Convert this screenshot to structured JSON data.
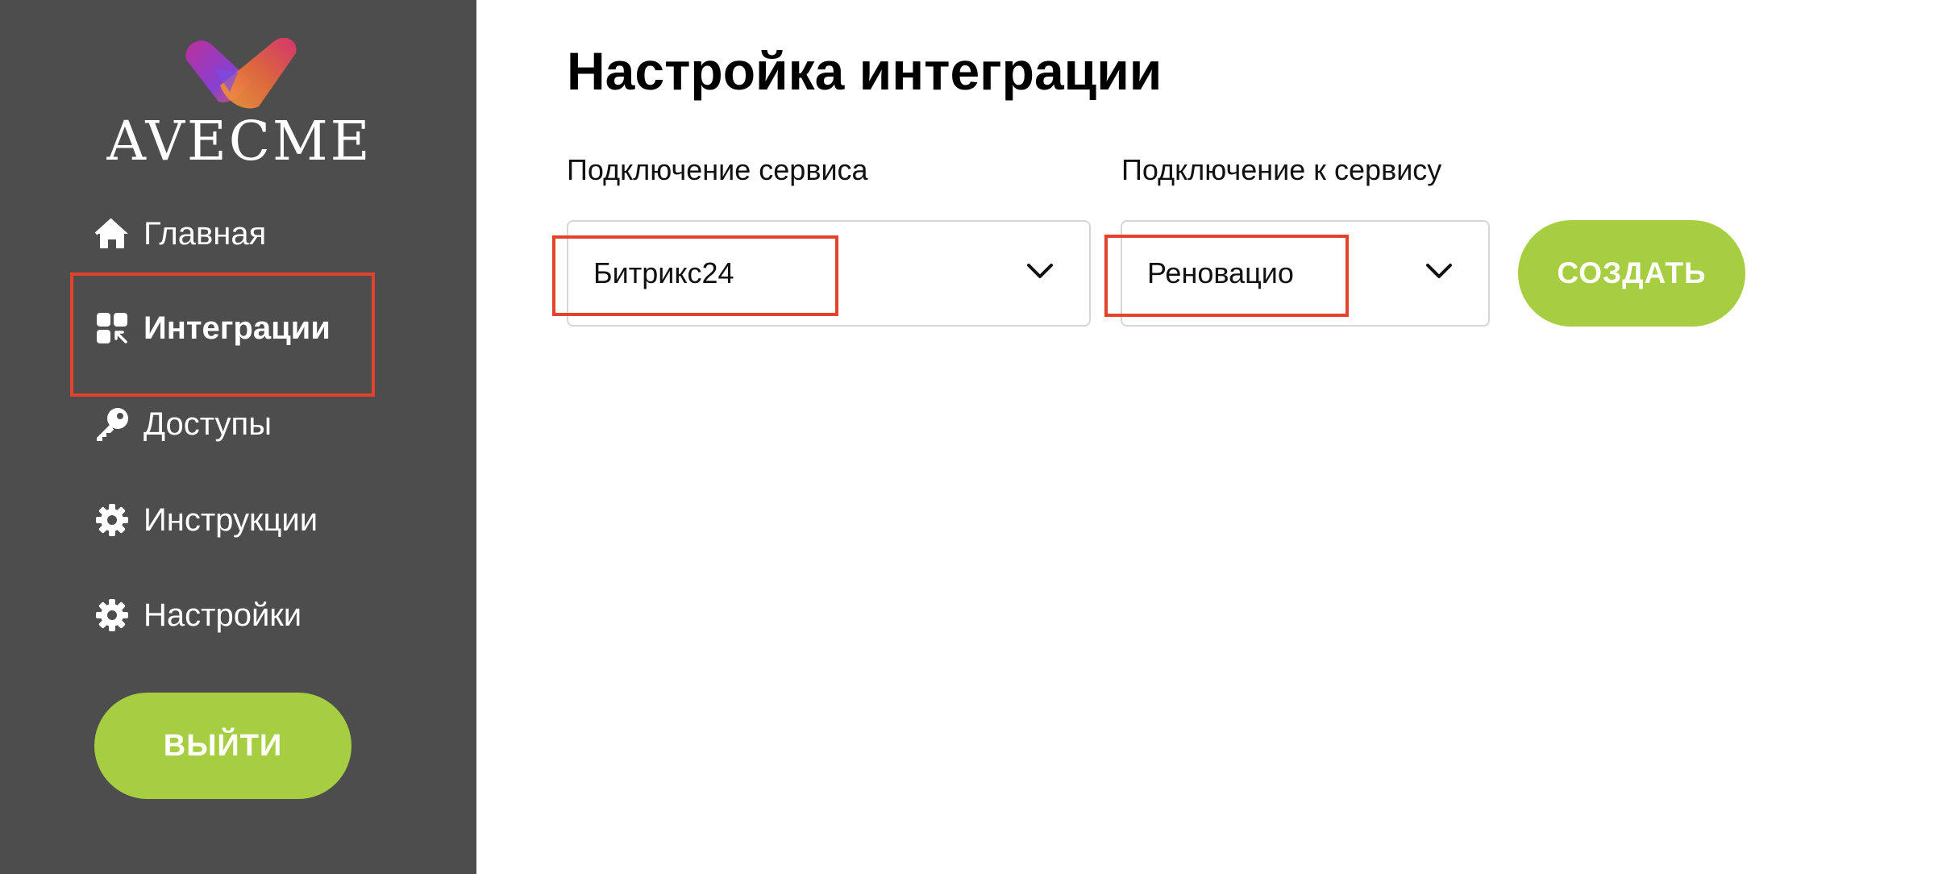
{
  "brand": {
    "name": "AVECME",
    "colors": {
      "sidebar": "#4d4d4d",
      "accent": "#a7cd43",
      "highlight": "#e3422c"
    }
  },
  "sidebar": {
    "items": [
      {
        "label": "Главная",
        "icon": "home-icon"
      },
      {
        "label": "Интеграции",
        "icon": "integrations-icon",
        "active": true
      },
      {
        "label": "Доступы",
        "icon": "key-icon"
      },
      {
        "label": "Инструкции",
        "icon": "gear-icon"
      },
      {
        "label": "Настройки",
        "icon": "gear-icon"
      }
    ],
    "logout_label": "ВЫЙТИ"
  },
  "main": {
    "title": "Настройка интеграции",
    "service_label": "Подключение сервиса",
    "service_value": "Битрикс24",
    "target_label": "Подключение к сервису",
    "target_value": "Реновацио",
    "create_label": "СОЗДАТЬ"
  }
}
